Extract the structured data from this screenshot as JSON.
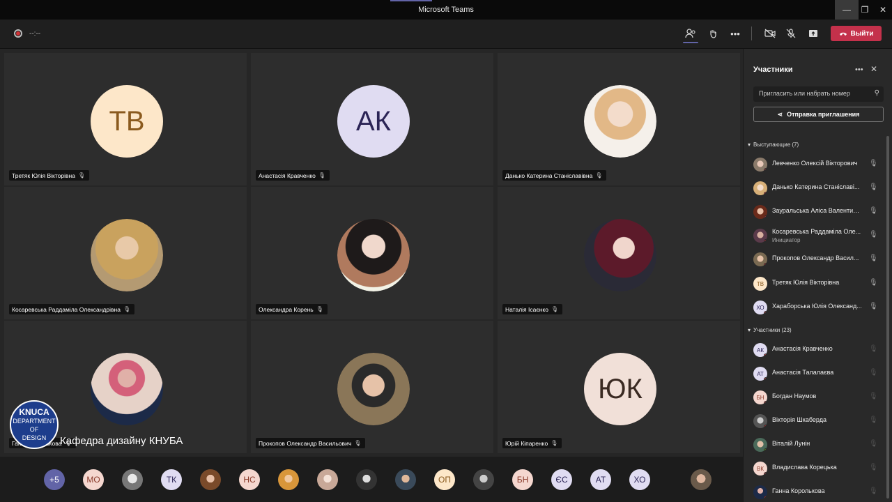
{
  "window": {
    "title": "Microsoft Teams",
    "min": "—",
    "max": "❐",
    "close": "✕"
  },
  "toolbar": {
    "record_time": "--:--",
    "participants_icon": "people-icon",
    "leave_label": "Выйти",
    "colors": {
      "accent": "#6264a7",
      "leave": "#c4314b"
    }
  },
  "tiles": [
    {
      "name": "Третяк Юлія Вікторівна",
      "initials": "ТВ",
      "bg": "#fde7c9",
      "fg": "#8a5a1e"
    },
    {
      "name": "Анастасія Кравченко",
      "initials": "АК",
      "bg": "#e0dcf2",
      "fg": "#2b2456"
    },
    {
      "name": "Данько Катерина Станіславівна",
      "initials": "",
      "bg": "#e8d2c0",
      "fg": "#000"
    },
    {
      "name": "Косаревська Раддаміла Олександрівна",
      "initials": "",
      "bg": "#b59a6a",
      "fg": "#000"
    },
    {
      "name": "Олександра Корень",
      "initials": "",
      "bg": "#a46c54",
      "fg": "#000"
    },
    {
      "name": "Наталія Ісаєнко",
      "initials": "",
      "bg": "#6b1a2c",
      "fg": "#000"
    },
    {
      "name": "Ганна Королькова",
      "initials": "",
      "bg": "#2a3a5c",
      "fg": "#000"
    },
    {
      "name": "Прокопов Олександр Васильович",
      "initials": "",
      "bg": "#7a6a52",
      "fg": "#000"
    },
    {
      "name": "Юрій Кіпаренко",
      "initials": "ЮК",
      "bg": "#f1e0d8",
      "fg": "#3a2a22"
    }
  ],
  "watermark": {
    "logo_line1": "KNUCA",
    "logo_line2": "DEPARTMENT",
    "logo_line3": "OF",
    "logo_line4": "DESIGN",
    "text": "Кафедра дизайну КНУБА"
  },
  "bottom_bar": [
    {
      "label": "+5",
      "bg": "#6264a7",
      "fg": "#fff"
    },
    {
      "label": "МО",
      "bg": "#f5d7cf",
      "fg": "#8a3a2a"
    },
    {
      "label": "",
      "bg": "#c9c9c9",
      "fg": "#000"
    },
    {
      "label": "ТК",
      "bg": "#e0dcf2",
      "fg": "#2b2456"
    },
    {
      "label": "",
      "bg": "#8a5a3a",
      "fg": "#000"
    },
    {
      "label": "НС",
      "bg": "#f5d7cf",
      "fg": "#8a3a2a"
    },
    {
      "label": "",
      "bg": "#e7b36a",
      "fg": "#000"
    },
    {
      "label": "",
      "bg": "#d8b8a8",
      "fg": "#000"
    },
    {
      "label": "",
      "bg": "#555",
      "fg": "#000"
    },
    {
      "label": "",
      "bg": "#4a5a6a",
      "fg": "#000"
    },
    {
      "label": "ОП",
      "bg": "#fde7c9",
      "fg": "#8a5a1e"
    },
    {
      "label": "",
      "bg": "#777",
      "fg": "#000"
    },
    {
      "label": "БН",
      "bg": "#f5d7cf",
      "fg": "#8a3a2a"
    },
    {
      "label": "ЄС",
      "bg": "#e0dcf2",
      "fg": "#2b2456"
    },
    {
      "label": "АТ",
      "bg": "#e0dcf2",
      "fg": "#2b2456"
    },
    {
      "label": "ХО",
      "bg": "#e0dcf2",
      "fg": "#2b2456"
    },
    {
      "label": "",
      "bg": "#c9a08a",
      "fg": "#000"
    }
  ],
  "panel": {
    "title": "Участники",
    "search_placeholder": "Пригласить или набрать номер",
    "invite_label": "Отправка приглашения",
    "presenters_label": "Выступающие (7)",
    "attendees_label": "Участники (23)",
    "presenters": [
      {
        "name": "Левченко Олексій Вікторович",
        "initials": "",
        "bg": "#b08a7a",
        "fg": "#000"
      },
      {
        "name": "Данько Катерина Станіславі...",
        "initials": "",
        "bg": "#e8d2c0",
        "fg": "#000"
      },
      {
        "name": "Зауральська Аліса Валентині...",
        "initials": "",
        "bg": "#8a4a3a",
        "fg": "#000"
      },
      {
        "name": "Косаревська Раддаміла Оле...",
        "initials": "",
        "bg": "#6a4a5a",
        "fg": "#000",
        "sub": "Инициатор"
      },
      {
        "name": "Прокопов Олександр Васил...",
        "initials": "",
        "bg": "#7a6a52",
        "fg": "#000"
      },
      {
        "name": "Третяк Юлія Вікторівна",
        "initials": "ТВ",
        "bg": "#fde7c9",
        "fg": "#8a5a1e"
      },
      {
        "name": "Хараборська Юлія Олександ...",
        "initials": "ХО",
        "bg": "#e0dcf2",
        "fg": "#2b2456"
      }
    ],
    "attendees": [
      {
        "name": "Анастасія Кравченко",
        "initials": "АК",
        "bg": "#e0dcf2",
        "fg": "#2b2456"
      },
      {
        "name": "Анастасія Талалаєва",
        "initials": "АТ",
        "bg": "#e0dcf2",
        "fg": "#2b2456"
      },
      {
        "name": "Богдан Наумов",
        "initials": "БН",
        "bg": "#f5d7cf",
        "fg": "#8a3a2a"
      },
      {
        "name": "Вікторія Шкаберда",
        "initials": "",
        "bg": "#666",
        "fg": "#000"
      },
      {
        "name": "Віталій Лунін",
        "initials": "",
        "bg": "#5a8a6a",
        "fg": "#000"
      },
      {
        "name": "Владислава Корецька",
        "initials": "ВК",
        "bg": "#f5d7cf",
        "fg": "#8a3a2a"
      },
      {
        "name": "Ганна Королькова",
        "initials": "",
        "bg": "#2a3a5c",
        "fg": "#000"
      }
    ]
  }
}
